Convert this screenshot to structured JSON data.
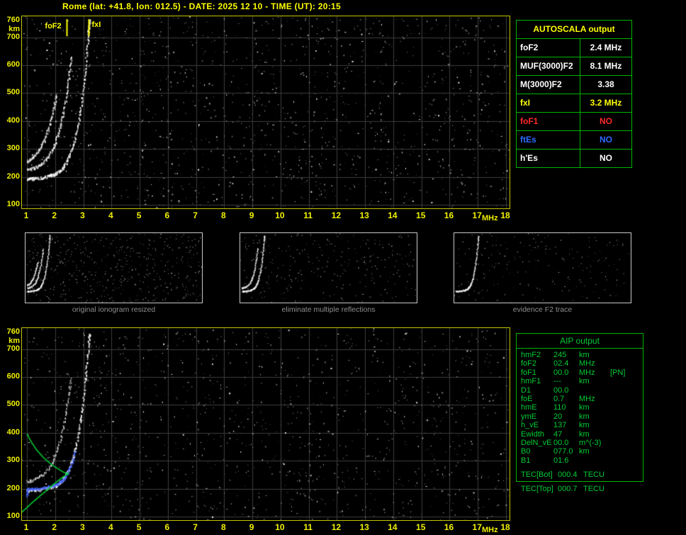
{
  "title": "Rome (lat: +41.8, lon: 012.5) - DATE: 2025 12 10 - TIME (UT): 20:15",
  "colors": {
    "background": "#000000",
    "title": "#ffff00",
    "axis_text": "#f0f000",
    "plot_border": "#c4c400",
    "grid": "#3d3d3d",
    "marker": "#ffff00",
    "table_border": "#00b400",
    "aip_text": "#00cc33",
    "caption": "#8f8f8f",
    "thumbnail_border": "#c8c8c8"
  },
  "axes": {
    "x_ticks": [
      "1",
      "2",
      "3",
      "4",
      "5",
      "6",
      "7",
      "8",
      "9",
      "10",
      "11",
      "12",
      "13",
      "14",
      "15",
      "16",
      "17",
      "18"
    ],
    "x_unit": "MHz",
    "y_ticks": [
      "760",
      "700",
      "600",
      "500",
      "400",
      "300",
      "200",
      "100"
    ],
    "y_unit": "km"
  },
  "autoscala": {
    "title": "AUTOSCALA output",
    "rows": [
      {
        "param": "foF2",
        "value": "2.4 MHz",
        "color": "#ffffff"
      },
      {
        "param": "MUF(3000)F2",
        "value": "8.1 MHz",
        "color": "#ffffff"
      },
      {
        "param": "M(3000)F2",
        "value": "3.38",
        "color": "#ffffff"
      },
      {
        "param": "fxI",
        "value": "3.2 MHz",
        "color": "#ffff00"
      },
      {
        "param": "foF1",
        "value": "NO",
        "color": "#ff2828"
      },
      {
        "param": "ftEs",
        "value": "NO",
        "color": "#2e6bff"
      },
      {
        "param": "h'Es",
        "value": "NO",
        "color": "#ffffff"
      }
    ]
  },
  "thumbnails": {
    "items": [
      {
        "caption": "original ionogram resized",
        "series_shown": [
          0,
          1,
          2
        ],
        "noise_dots": 520,
        "seed": 31
      },
      {
        "caption": "eliminate multiple reflections",
        "series_shown": [
          0,
          1
        ],
        "noise_dots": 300,
        "seed": 47
      },
      {
        "caption": "evidence F2 trace",
        "series_shown": [
          0
        ],
        "noise_dots": 200,
        "seed": 63
      }
    ]
  },
  "aip": {
    "title": "AIP output",
    "rows": [
      {
        "param": "hmF2",
        "value": "245",
        "unit": "km",
        "note": ""
      },
      {
        "param": "foF2",
        "value": "02.4",
        "unit": "MHz",
        "note": ""
      },
      {
        "param": "foF1",
        "value": "00.0",
        "unit": "MHz",
        "note": "[PN]"
      },
      {
        "param": "hmF1",
        "value": "---",
        "unit": "km",
        "note": ""
      },
      {
        "param": "D1",
        "value": "00.0",
        "unit": "",
        "note": ""
      },
      {
        "param": "foE",
        "value": "0.7",
        "unit": "MHz",
        "note": ""
      },
      {
        "param": "hmE",
        "value": "110",
        "unit": "km",
        "note": ""
      },
      {
        "param": "ymE",
        "value": "20",
        "unit": "km",
        "note": ""
      },
      {
        "param": "h_vE",
        "value": "137",
        "unit": "km",
        "note": ""
      },
      {
        "param": "Ewidth",
        "value": "47",
        "unit": "km",
        "note": ""
      },
      {
        "param": "DelN_vE",
        "value": "00.0",
        "unit": "m^(-3)",
        "note": ""
      },
      {
        "param": "B0",
        "value": "077.0",
        "unit": "km",
        "note": ""
      },
      {
        "param": "B1",
        "value": "01.6",
        "unit": "",
        "note": ""
      },
      {
        "param": "TEC[Bot]",
        "value": "000.4",
        "unit": "TECU",
        "note": ""
      }
    ],
    "tec_top": {
      "param": "TEC[Top]",
      "value": "000.7",
      "unit": "TECU"
    }
  },
  "chart_data": [
    {
      "id": "top-ionogram",
      "type": "scatter",
      "title": "measured ionogram with AUTOSCALA markers",
      "xlabel": "MHz",
      "ylabel": "km",
      "x_range": [
        1,
        18
      ],
      "y_range": [
        100,
        760
      ],
      "grid": true,
      "noise_dots": 1500,
      "seed": 12345,
      "annotations": [
        {
          "label": "foF2",
          "x_mhz": 2.4
        },
        {
          "label": "fxI",
          "x_mhz": 3.2
        }
      ],
      "series": [
        {
          "name": "F2 trace 1st hop",
          "style": "echo",
          "color": "#ffffff",
          "density": 180,
          "points": [
            [
              1.0,
              196
            ],
            [
              1.2,
              196
            ],
            [
              1.5,
              199
            ],
            [
              1.8,
              205
            ],
            [
              2.0,
              213
            ],
            [
              2.2,
              227
            ],
            [
              2.35,
              246
            ],
            [
              2.5,
              278
            ],
            [
              2.65,
              322
            ],
            [
              2.8,
              388
            ],
            [
              2.92,
              462
            ],
            [
              3.02,
              548
            ],
            [
              3.1,
              632
            ],
            [
              3.17,
              716
            ],
            [
              3.21,
              760
            ]
          ]
        },
        {
          "name": "multiple reflection 2",
          "style": "echo",
          "color": "#f0f0f0",
          "density": 120,
          "points": [
            [
              1.0,
              228
            ],
            [
              1.25,
              234
            ],
            [
              1.5,
              248
            ],
            [
              1.75,
              274
            ],
            [
              1.95,
              312
            ],
            [
              2.1,
              358
            ],
            [
              2.25,
              418
            ],
            [
              2.38,
              488
            ],
            [
              2.48,
              558
            ],
            [
              2.56,
              632
            ]
          ]
        },
        {
          "name": "multiple reflection 3",
          "style": "echo",
          "color": "#e6e6e6",
          "density": 90,
          "points": [
            [
              1.0,
              258
            ],
            [
              1.2,
              272
            ],
            [
              1.4,
              296
            ],
            [
              1.6,
              332
            ],
            [
              1.78,
              382
            ],
            [
              1.92,
              438
            ],
            [
              2.03,
              496
            ]
          ]
        }
      ]
    },
    {
      "id": "bottom-ionogram",
      "type": "scatter",
      "title": "ionogram with AIP inverted profile",
      "xlabel": "MHz",
      "ylabel": "km",
      "x_range": [
        1,
        18
      ],
      "y_range": [
        100,
        760
      ],
      "grid": true,
      "noise_dots": 1250,
      "seed": 77001,
      "annotations": [],
      "series": [
        {
          "name": "F2 trace",
          "style": "echo",
          "color": "#ffffff",
          "density": 180,
          "points": [
            [
              1.0,
              196
            ],
            [
              1.2,
              196
            ],
            [
              1.5,
              199
            ],
            [
              1.8,
              205
            ],
            [
              2.0,
              213
            ],
            [
              2.2,
              227
            ],
            [
              2.35,
              246
            ],
            [
              2.5,
              278
            ],
            [
              2.65,
              322
            ],
            [
              2.8,
              388
            ],
            [
              2.92,
              462
            ],
            [
              3.02,
              548
            ],
            [
              3.1,
              632
            ],
            [
              3.17,
              716
            ],
            [
              3.21,
              760
            ]
          ]
        },
        {
          "name": "faint 2nd reflection",
          "style": "echo",
          "color": "#d4d4d4",
          "density": 80,
          "points": [
            [
              1.0,
              228
            ],
            [
              1.3,
              236
            ],
            [
              1.6,
              256
            ],
            [
              1.9,
              296
            ],
            [
              2.1,
              352
            ],
            [
              2.3,
              430
            ],
            [
              2.45,
              520
            ],
            [
              2.55,
              600
            ]
          ]
        },
        {
          "name": "autoscala scaled points",
          "style": "dots",
          "color": "#4565ff",
          "density": 150,
          "points": [
            [
              1.0,
              176
            ],
            [
              1.0,
              200
            ],
            [
              1.15,
              200
            ],
            [
              1.3,
              201
            ],
            [
              1.5,
              203
            ],
            [
              1.7,
              206
            ],
            [
              1.9,
              211
            ],
            [
              2.05,
              217
            ],
            [
              2.2,
              227
            ],
            [
              2.3,
              237
            ],
            [
              2.4,
              252
            ],
            [
              2.5,
              272
            ],
            [
              2.6,
              300
            ],
            [
              2.7,
              338
            ]
          ]
        },
        {
          "name": "AIP bottomside profile",
          "style": "line",
          "color": "#00cc33",
          "points": [
            [
              0.78,
              112
            ],
            [
              0.95,
              128
            ],
            [
              1.2,
              151
            ],
            [
              1.5,
              177
            ],
            [
              1.8,
              203
            ],
            [
              2.05,
              224
            ],
            [
              2.25,
              240
            ],
            [
              2.4,
              250
            ],
            [
              2.48,
              258
            ]
          ]
        },
        {
          "name": "AIP topside profile",
          "style": "line",
          "color": "#00cc33",
          "points": [
            [
              1.0,
              396
            ],
            [
              1.15,
              368
            ],
            [
              1.35,
              338
            ],
            [
              1.6,
              310
            ],
            [
              1.85,
              288
            ],
            [
              2.1,
              271
            ],
            [
              2.3,
              259
            ],
            [
              2.48,
              251
            ]
          ]
        }
      ]
    }
  ]
}
